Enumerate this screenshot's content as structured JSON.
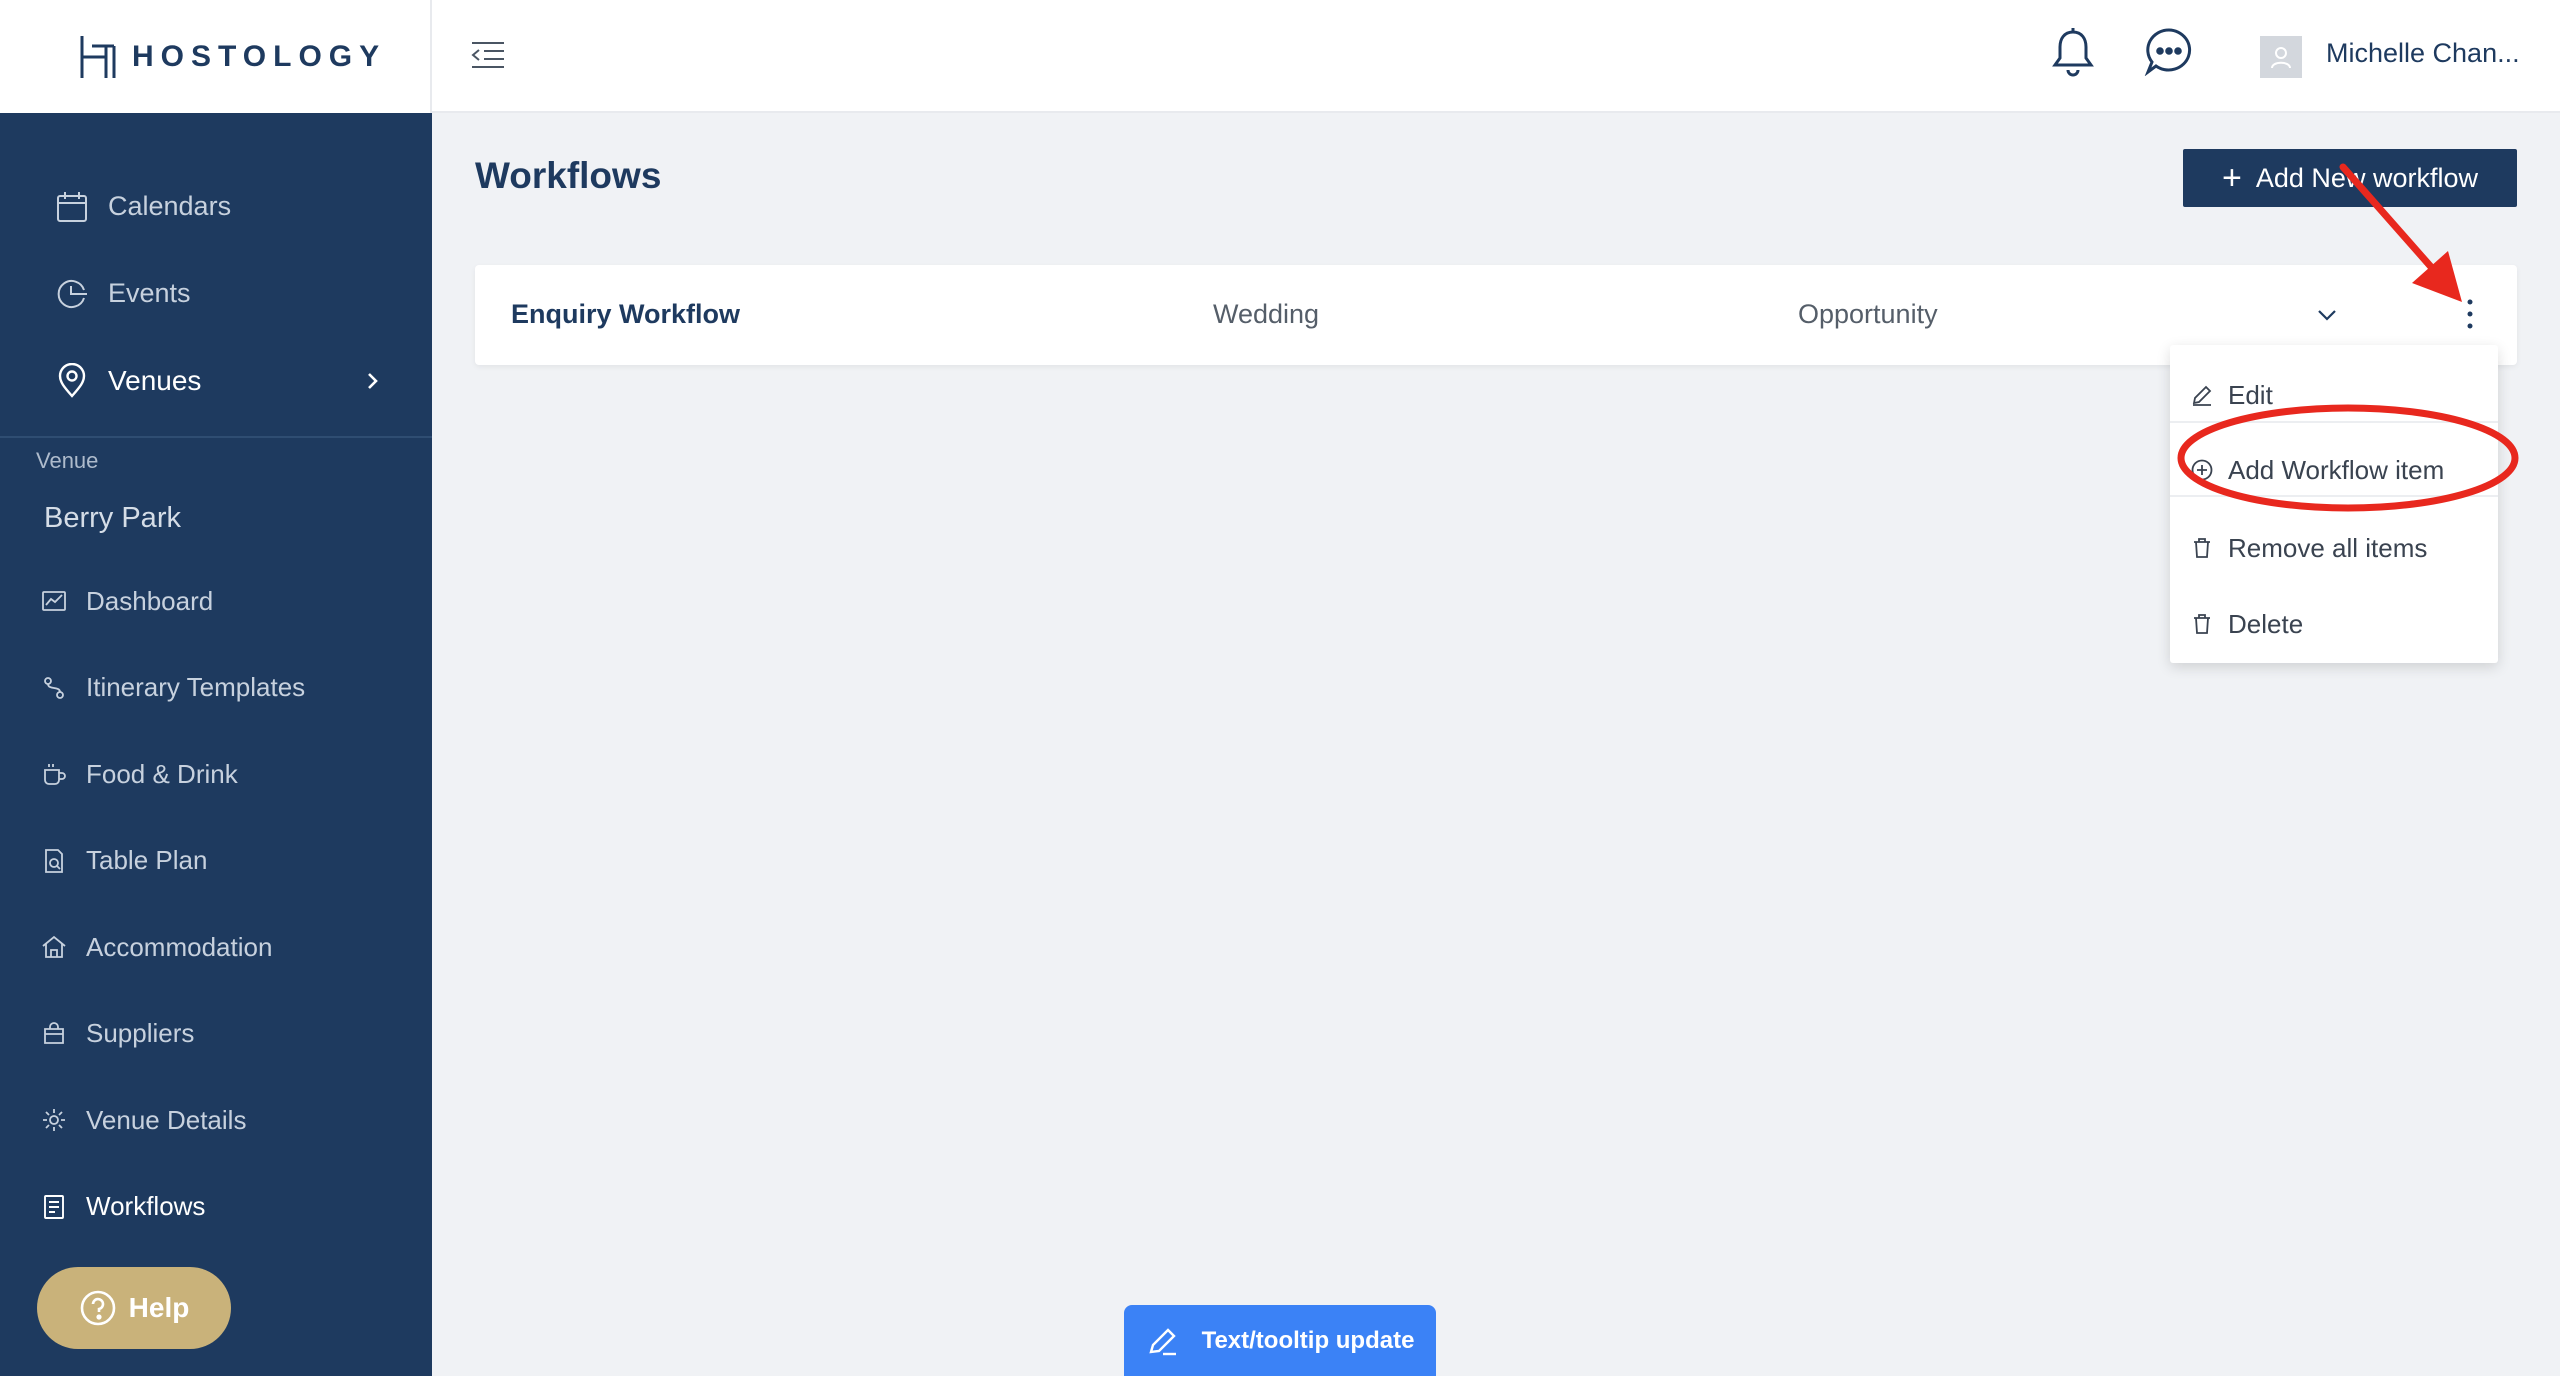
{
  "brand": {
    "name": "HOSTOLOGY"
  },
  "sidebar": {
    "top_items": [
      {
        "label": "Calendars"
      },
      {
        "label": "Events"
      },
      {
        "label": "Venues"
      }
    ],
    "section_label": "Venue",
    "venue_name": "Berry Park",
    "sub_items": [
      {
        "label": "Dashboard"
      },
      {
        "label": "Itinerary Templates"
      },
      {
        "label": "Food & Drink"
      },
      {
        "label": "Table Plan"
      },
      {
        "label": "Accommodation"
      },
      {
        "label": "Suppliers"
      },
      {
        "label": "Venue Details"
      },
      {
        "label": "Workflows"
      }
    ],
    "help_label": "Help"
  },
  "topbar": {
    "user_name": "Michelle Chan..."
  },
  "main": {
    "title": "Workflows",
    "add_button_label": "Add New workflow",
    "workflow": {
      "name": "Enquiry Workflow",
      "type": "Wedding",
      "stage": "Opportunity"
    },
    "menu": [
      {
        "label": "Edit",
        "icon": "pencil-icon"
      },
      {
        "label": "Add Workflow item",
        "icon": "plus-circle-icon"
      },
      {
        "label": "Remove all items",
        "icon": "trash-icon"
      },
      {
        "label": "Delete",
        "icon": "trash-icon"
      }
    ]
  },
  "tooltip_button": {
    "label": "Text/tooltip update"
  },
  "colors": {
    "sidebar": "#1e3a5f",
    "accent": "#c9b27a",
    "annotation": "#e8281e",
    "tooltip": "#3b82f6"
  }
}
